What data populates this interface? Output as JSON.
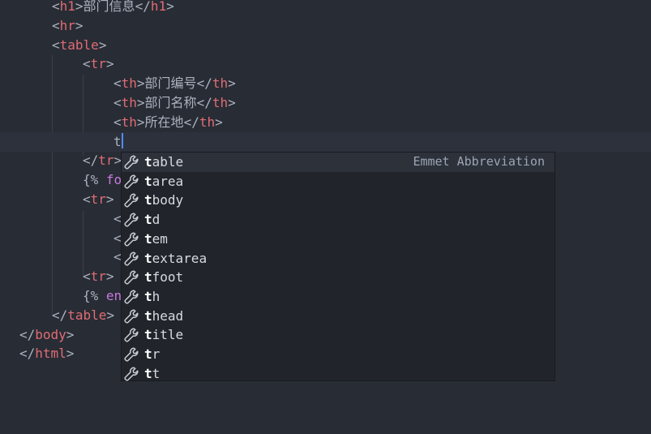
{
  "code_lines": [
    {
      "indent": 64,
      "parts": [
        [
          "punct",
          "<"
        ],
        [
          "tag",
          "h1"
        ],
        [
          "punct",
          ">"
        ],
        [
          "text",
          "部门信息"
        ],
        [
          "punct",
          "</"
        ],
        [
          "tag",
          "h1"
        ],
        [
          "punct",
          ">"
        ]
      ]
    },
    {
      "indent": 64,
      "parts": [
        [
          "punct",
          "<"
        ],
        [
          "tag",
          "hr"
        ],
        [
          "punct",
          ">"
        ]
      ]
    },
    {
      "indent": 64,
      "parts": [
        [
          "punct",
          "<"
        ],
        [
          "tag",
          "table"
        ],
        [
          "punct",
          ">"
        ]
      ]
    },
    {
      "indent": 102,
      "parts": [
        [
          "punct",
          "<"
        ],
        [
          "tag",
          "tr"
        ],
        [
          "punct",
          ">"
        ]
      ]
    },
    {
      "indent": 140,
      "parts": [
        [
          "punct",
          "<"
        ],
        [
          "tag",
          "th"
        ],
        [
          "punct",
          ">"
        ],
        [
          "text",
          "部门编号"
        ],
        [
          "punct",
          "</"
        ],
        [
          "tag",
          "th"
        ],
        [
          "punct",
          ">"
        ]
      ]
    },
    {
      "indent": 140,
      "parts": [
        [
          "punct",
          "<"
        ],
        [
          "tag",
          "th"
        ],
        [
          "punct",
          ">"
        ],
        [
          "text",
          "部门名称"
        ],
        [
          "punct",
          "</"
        ],
        [
          "tag",
          "th"
        ],
        [
          "punct",
          ">"
        ]
      ]
    },
    {
      "indent": 140,
      "parts": [
        [
          "punct",
          "<"
        ],
        [
          "tag",
          "th"
        ],
        [
          "punct",
          ">"
        ],
        [
          "text",
          "所在地"
        ],
        [
          "punct",
          "</"
        ],
        [
          "tag",
          "th"
        ],
        [
          "punct",
          ">"
        ]
      ]
    },
    {
      "indent": 140,
      "parts": [
        [
          "text",
          "t"
        ]
      ],
      "cursor": true,
      "current": true
    },
    {
      "indent": 102,
      "parts": [
        [
          "punct",
          "</"
        ],
        [
          "tag",
          "tr"
        ],
        [
          "punct",
          ">"
        ]
      ]
    },
    {
      "indent": 102,
      "parts": [
        [
          "punct",
          "{% "
        ],
        [
          "kw",
          "fo"
        ]
      ]
    },
    {
      "indent": 102,
      "parts": [
        [
          "punct",
          "<"
        ],
        [
          "tag",
          "tr"
        ],
        [
          "punct",
          ">"
        ]
      ]
    },
    {
      "indent": 140,
      "parts": [
        [
          "punct",
          "<"
        ]
      ]
    },
    {
      "indent": 140,
      "parts": [
        [
          "punct",
          "<"
        ]
      ]
    },
    {
      "indent": 140,
      "parts": [
        [
          "punct",
          "<"
        ]
      ]
    },
    {
      "indent": 102,
      "parts": [
        [
          "punct",
          "<"
        ],
        [
          "tag",
          "tr"
        ],
        [
          "punct",
          ">"
        ]
      ]
    },
    {
      "indent": 102,
      "parts": [
        [
          "punct",
          "{% "
        ],
        [
          "kw",
          "en"
        ]
      ]
    },
    {
      "indent": 64,
      "parts": [
        [
          "punct",
          "</"
        ],
        [
          "tag",
          "table"
        ],
        [
          "punct",
          ">"
        ]
      ]
    },
    {
      "indent": 24,
      "parts": [
        [
          "punct",
          "</"
        ],
        [
          "tag",
          "body"
        ],
        [
          "punct",
          ">"
        ]
      ]
    },
    {
      "indent": 24,
      "parts": [
        [
          "punct",
          "</"
        ],
        [
          "tag",
          "html"
        ],
        [
          "punct",
          ">"
        ]
      ]
    }
  ],
  "autocomplete": {
    "typed_prefix": "t",
    "items": [
      {
        "prefix": "t",
        "rest": "able",
        "description": "Emmet Abbreviation",
        "selected": true
      },
      {
        "prefix": "t",
        "rest": "area"
      },
      {
        "prefix": "t",
        "rest": "body"
      },
      {
        "prefix": "t",
        "rest": "d"
      },
      {
        "prefix": "t",
        "rest": "em"
      },
      {
        "prefix": "t",
        "rest": "extarea"
      },
      {
        "prefix": "t",
        "rest": "foot"
      },
      {
        "prefix": "t",
        "rest": "h"
      },
      {
        "prefix": "t",
        "rest": "head"
      },
      {
        "prefix": "t",
        "rest": "itle"
      },
      {
        "prefix": "t",
        "rest": "r"
      },
      {
        "prefix": "t",
        "rest": "t"
      }
    ],
    "item_icon": "wrench-icon"
  },
  "colors": {
    "background": "#282c34",
    "tag": "#e06c75",
    "keyword": "#c678dd",
    "text": "#abb2bf",
    "cursor": "#528bff",
    "popup_background": "#21252b"
  }
}
